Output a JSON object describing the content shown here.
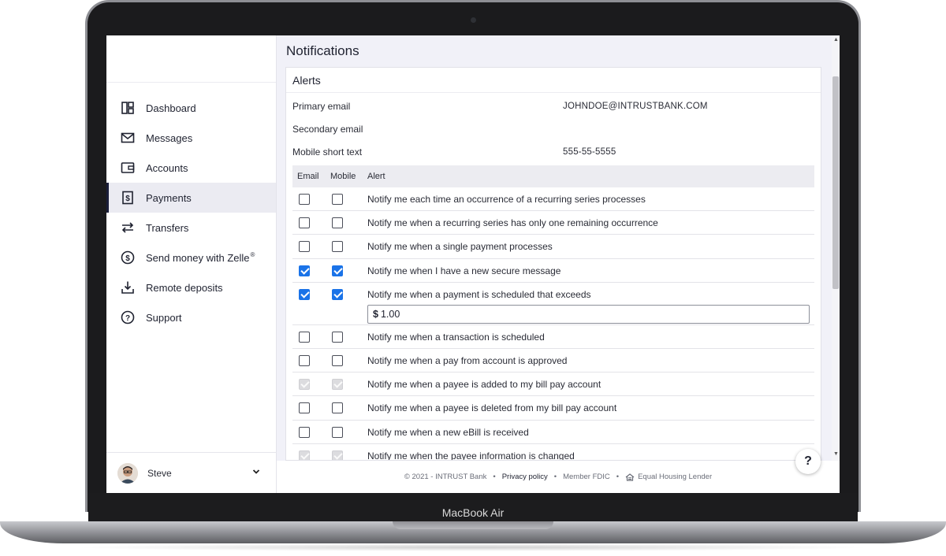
{
  "device": {
    "model": "MacBook Air"
  },
  "sidebar": {
    "items": [
      {
        "label": "Dashboard",
        "icon": "dashboard-icon",
        "active": false
      },
      {
        "label": "Messages",
        "icon": "envelope-icon",
        "active": false
      },
      {
        "label": "Accounts",
        "icon": "wallet-icon",
        "active": false
      },
      {
        "label": "Payments",
        "icon": "dollar-document-icon",
        "active": true
      },
      {
        "label": "Transfers",
        "icon": "transfer-arrows-icon",
        "active": false
      },
      {
        "label": "Send money with Zelle",
        "label_sup": "®",
        "icon": "dollar-circle-icon",
        "active": false
      },
      {
        "label": "Remote deposits",
        "icon": "download-tray-icon",
        "active": false
      },
      {
        "label": "Support",
        "icon": "question-circle-icon",
        "active": false
      }
    ],
    "user": {
      "name": "Steve"
    }
  },
  "main": {
    "title": "Notifications",
    "alerts": {
      "title": "Alerts",
      "contacts": [
        {
          "label": "Primary email",
          "value": "JOHNDOE@INTRUSTBANK.COM"
        },
        {
          "label": "Secondary email",
          "value": ""
        },
        {
          "label": "Mobile short text",
          "value": "555-55-5555"
        }
      ],
      "columns": {
        "email": "Email",
        "mobile": "Mobile",
        "alert": "Alert"
      },
      "rows": [
        {
          "text": "Notify me each time an occurrence of a recurring series processes",
          "email": false,
          "mobile": false,
          "disabled": false
        },
        {
          "text": "Notify me when a recurring series has only one remaining occurrence",
          "email": false,
          "mobile": false,
          "disabled": false
        },
        {
          "text": "Notify me when a single payment processes",
          "email": false,
          "mobile": false,
          "disabled": false
        },
        {
          "text": "Notify me when I have a new secure message",
          "email": true,
          "mobile": true,
          "disabled": false
        },
        {
          "text": "Notify me when a payment is scheduled that exceeds",
          "email": true,
          "mobile": true,
          "disabled": false,
          "amount": {
            "currency": "$",
            "value": "1.00"
          }
        },
        {
          "text": "Notify me when a transaction is scheduled",
          "email": false,
          "mobile": false,
          "disabled": false
        },
        {
          "text": "Notify me when a pay from account is approved",
          "email": false,
          "mobile": false,
          "disabled": false
        },
        {
          "text": "Notify me when a payee is added to my bill pay account",
          "email": true,
          "mobile": true,
          "disabled": true
        },
        {
          "text": "Notify me when a payee is deleted from my bill pay account",
          "email": false,
          "mobile": false,
          "disabled": false
        },
        {
          "text": "Notify me when a new eBill is received",
          "email": false,
          "mobile": false,
          "disabled": false
        },
        {
          "text": "Notify me when the payee information is changed",
          "email": true,
          "mobile": true,
          "disabled": true
        }
      ]
    }
  },
  "footer": {
    "copyright": "© 2021 - INTRUST Bank",
    "privacy": "Privacy policy",
    "fdic": "Member FDIC",
    "housing": "Equal Housing Lender",
    "separator": "•"
  },
  "help": {
    "label": "?"
  }
}
